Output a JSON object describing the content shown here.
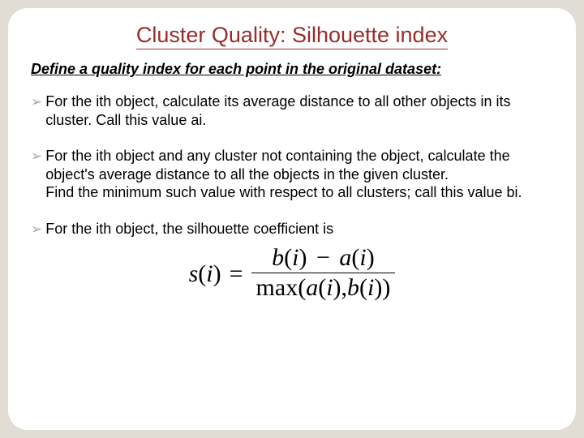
{
  "title": "Cluster Quality: Silhouette index",
  "subhead": "Define a quality index for each point in the original dataset:",
  "bullets": [
    "For the ith object, calculate its average distance to all other objects  in its cluster. Call this value ai.",
    "For the ith object and any cluster not containing the object, calculate the object's average distance to all the objects in the given cluster.\nFind the minimum such value with respect to all clusters; call this value bi.",
    "For the ith object, the silhouette coefficient is"
  ],
  "formula": {
    "lhs_var": "s",
    "lhs_arg": "i",
    "num_left_var": "b",
    "num_left_arg": "i",
    "minus": "−",
    "num_right_var": "a",
    "num_right_arg": "i",
    "den_func": "max",
    "den_a_var": "a",
    "den_a_arg": "i",
    "den_b_var": "b",
    "den_b_arg": "i"
  }
}
